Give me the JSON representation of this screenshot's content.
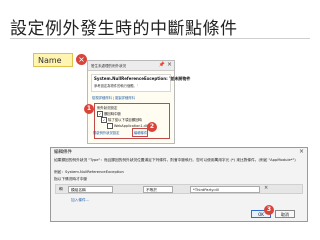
{
  "page": {
    "title": "設定例外發生時的中斷點條件"
  },
  "editor": {
    "name_tag": "Name",
    "error_mark": "×"
  },
  "exception_helper": {
    "header": "發生未處理的例外狀況",
    "pin_icon": "pin-icon",
    "close_icon": "close-icon",
    "exception_type": "System.NullReferenceException: '並未將物件",
    "exception_message": "參考設定為物件的執行個體。'",
    "links": "檢視詳細資料 | 複製詳細資料",
    "settings_header": "例外狀況設定",
    "break_when_thrown": "擲回時中斷",
    "except_when": "除了從以下項目擲回時",
    "app_item": "WebApplication1.dll",
    "settings_link": "開啟例外狀況設定",
    "edit_conditions_link": "編輯條件",
    "badges": [
      "1",
      "2"
    ]
  },
  "dialog": {
    "title": "編輯條件",
    "close_icon": "close-icon",
    "description": "如果擲回的例外狀況 \"Type\"：而且擲回的例外狀況位置滿足下列條件，則會中斷執行。您可以使用萬用字元 (*) 來比對條件。(例如 \"AppModule*\")",
    "condition_example": "例如：System.NullReferenceException",
    "add_condition_label": "指以下情況時才中斷",
    "field1_prefix": "和",
    "field1_value": "模組名稱",
    "field2_value": "不等於",
    "field3_value": "*ThirdParty.dll",
    "add_condition_link": "加入條件...",
    "ok_label": "OK",
    "cancel_label": "取消",
    "badge": "3"
  }
}
